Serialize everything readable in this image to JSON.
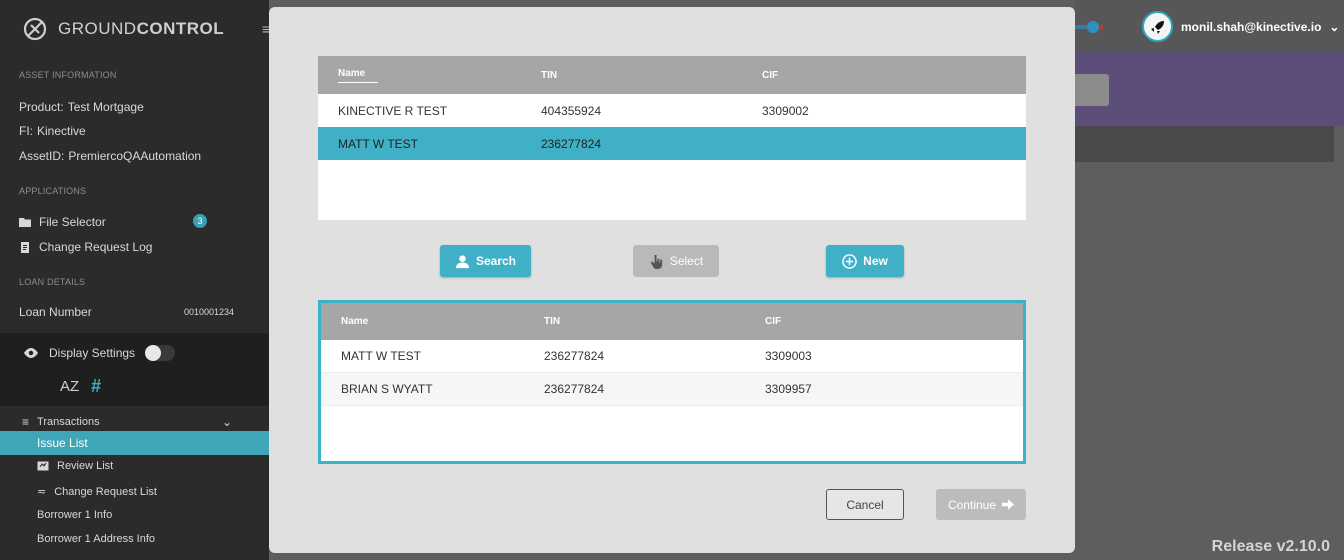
{
  "app": {
    "logo_prefix": "GROUND",
    "logo_suffix": "CONTROL",
    "release": "Release v2.10.0"
  },
  "user": {
    "email": "monil.shah@kinective.io",
    "chevron": "⌄"
  },
  "sidebar": {
    "asset_header": "ASSET INFORMATION",
    "product_label": "Product:",
    "product_value": "Test Mortgage",
    "fi_label": "FI:",
    "fi_value": "Kinective",
    "asset_label": "AssetID:",
    "asset_value": "PremiercoQAAutomation",
    "applications_header": "APPLICATIONS",
    "file_selector": "File Selector",
    "file_selector_badge": "3",
    "change_request_log": "Change Request Log",
    "loan_header": "LOAN DETAILS",
    "loan_number_label": "Loan Number",
    "loan_number_value": "0010001234",
    "display_settings": "Display Settings",
    "sort_az": "AZ",
    "sort_hash": "#",
    "transactions": "Transactions",
    "issue_list": "Issue List",
    "review_list": "Review List",
    "change_request_list": "Change Request List",
    "borrower_info": "Borrower 1 Info",
    "borrower_address": "Borrower 1 Address Info"
  },
  "modal": {
    "top_table": {
      "headers": [
        "Name",
        "TIN",
        "CIF"
      ],
      "rows": [
        {
          "name": "KINECTIVE R TEST",
          "tin": "404355924",
          "cif": "3309002",
          "selected": false
        },
        {
          "name": "MATT W TEST",
          "tin": "236277824",
          "cif": "",
          "selected": true
        }
      ]
    },
    "buttons": {
      "search": "Search",
      "select": "Select",
      "new": "New",
      "cancel": "Cancel",
      "continue": "Continue"
    },
    "bottom_table": {
      "headers": [
        "Name",
        "TIN",
        "CIF"
      ],
      "rows": [
        {
          "name": "MATT W TEST",
          "tin": "236277824",
          "cif": "3309003"
        },
        {
          "name": "BRIAN S WYATT",
          "tin": "236277824",
          "cif": "3309957"
        }
      ]
    }
  },
  "colors": {
    "accent": "#3fb0c6",
    "sidebar_bg": "#2b2b2b",
    "modal_bg": "#e0e0e0"
  }
}
